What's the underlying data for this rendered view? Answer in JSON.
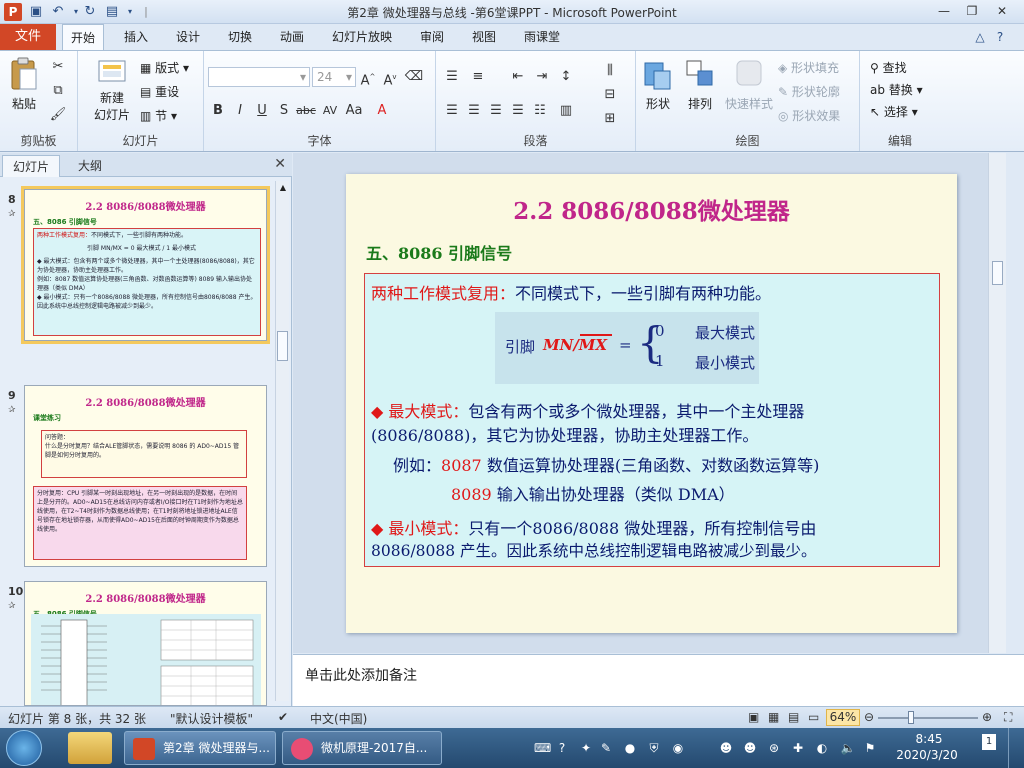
{
  "window": {
    "title": "第2章 微处理器与总线 -第6堂课PPT  -  Microsoft PowerPoint",
    "app_icon": "P",
    "controls": [
      "minimize-icon",
      "restore-icon",
      "close-icon"
    ]
  },
  "ribbon": {
    "file_tab": "文件",
    "tabs": [
      "开始",
      "插入",
      "设计",
      "切换",
      "动画",
      "幻灯片放映",
      "审阅",
      "视图",
      "雨课堂"
    ],
    "active_tab": "开始",
    "groups": {
      "clipboard": {
        "label": "剪贴板",
        "paste": "粘贴"
      },
      "slides": {
        "label": "幻灯片",
        "new_slide": "新建",
        "new_slide_2": "幻灯片",
        "layout": "版式",
        "reset": "重设",
        "section": "节"
      },
      "font": {
        "label": "字体",
        "size": "24"
      },
      "paragraph": {
        "label": "段落"
      },
      "drawing": {
        "label": "绘图",
        "shape": "形状",
        "arrange": "排列",
        "quick_styles": "快速样式",
        "fill": "形状填充",
        "outline": "形状轮廓",
        "effects": "形状效果"
      },
      "editing": {
        "label": "编辑",
        "find": "查找",
        "replace": "替换",
        "select": "选择"
      }
    }
  },
  "left_pane": {
    "tabs": [
      "幻灯片",
      "大纲"
    ],
    "thumbnails": [
      {
        "number": "8",
        "title": "2.2 8086/8088微处理器",
        "subtitle": "五、8086 引脚信号",
        "line1_red": "两种工作模式复用：",
        "line1": "不同模式下，一些引脚有两种功能。",
        "formula": "引脚 MN/MX = 0 最大模式 / 1 最小模式",
        "max_mode": "◆ 最大模式：包含有两个或多个微处理器，其中一个主处理器(8086/8088)，其它为协处理器，协助主处理器工作。",
        "example": "例如：8087 数值运算协处理器(三角函数、对数函数运算等)  8089 输入输出协处理器（类似 DMA）",
        "min_mode": "◆ 最小模式：只有一个8086/8088 微处理器，所有控制信号由8086/8088 产生。因此系统中总线控制逻辑电路被减少到最少。"
      },
      {
        "number": "9",
        "title": "2.2 8086/8088微处理器",
        "subtitle": "课堂练习",
        "q_label": "问答题：",
        "question": "什么是分时复用？结合ALE管脚状态，需要说明 8086 的 AD0~AD15 管脚是如何分时复用的。",
        "answer": "分时复用：CPU 引脚某一时刻出现地址，在另一时刻出现的是数据，在时间上是分开的。AD0~AD15在总线访问内存或者I/O接口时在T1时刻作为地址总线使用，在T2~T4时刻作为数据总线使用；在T1时刻将地址锁进地址ALE信号锁存在地址锁存器，从而使得AD0~AD15在后面的时钟周期变作为数据总线使用。"
      },
      {
        "number": "10",
        "title": "2.2 8086/8088微处理器",
        "subtitle": "五、8086 引脚信号"
      }
    ]
  },
  "slide": {
    "title": "2.2 8086/8088微处理器",
    "subtitle": "五、8086 引脚信号",
    "mode_reuse_label": "两种工作模式复用：",
    "mode_reuse_text": "不同模式下，一些引脚有两种功能。",
    "formula_pin": "引脚",
    "formula_signal": "MN/MX",
    "formula_eq": "=",
    "formula_zero": "0",
    "formula_one": "1",
    "formula_max": "最大模式",
    "formula_min": "最小模式",
    "max_mode_label": "◆ 最大模式：",
    "max_mode_text_1": "包含有两个或多个微处理器，其中一个主处理器",
    "max_mode_text_2": "(8086/8088)，其它为协处理器，协助主处理器工作。",
    "example_label": "例如：",
    "example_8087": "8087",
    "example_8087_text": " 数值运算协处理器(三角函数、对数函数运算等)",
    "example_8089": "8089",
    "example_8089_text": " 输入输出协处理器（类似 DMA）",
    "min_mode_label": "◆ 最小模式：",
    "min_mode_text_1": "只有一个8086/8088 微处理器，所有控制信号由",
    "min_mode_text_2": "8086/8088 产生。因此系统中总线控制逻辑电路被减少到最少。"
  },
  "notes": {
    "placeholder": "单击此处添加备注"
  },
  "statusbar": {
    "slide_info": "幻灯片 第 8 张，共 32 张",
    "theme": "\"默认设计模板\"",
    "language": "中文(中国)",
    "zoom": "64%"
  },
  "taskbar": {
    "buttons": [
      "第2章 微处理器与...",
      "微机原理-2017自..."
    ],
    "time": "8:45",
    "date": "2020/3/20"
  },
  "colors": {
    "accent": "#d24726",
    "slide_title": "#c0268a",
    "subtitle_green": "#1a7a1a",
    "red_text": "#e01818",
    "box_bg": "#d6f4f6"
  }
}
